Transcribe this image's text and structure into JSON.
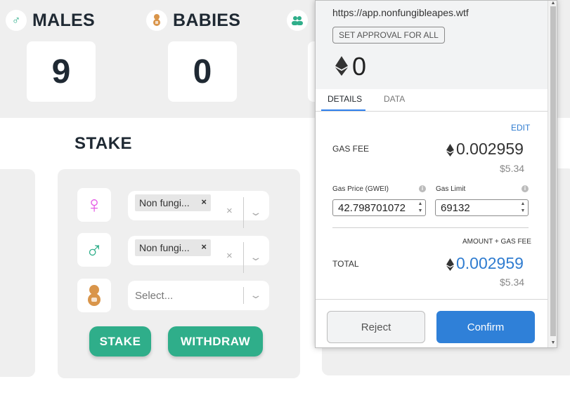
{
  "stats": {
    "males": {
      "label": "MALES",
      "value": "9",
      "icon": "male-icon"
    },
    "babies": {
      "label": "BABIES",
      "value": "0",
      "icon": "baby-icon"
    },
    "third": {
      "icon": "group-icon"
    }
  },
  "stake": {
    "title": "STAKE",
    "female_select": {
      "tag": "Non fungi...",
      "remove": "×",
      "clear": "×"
    },
    "male_select": {
      "tag": "Non fungi...",
      "remove": "×",
      "clear": "×"
    },
    "baby_select": {
      "placeholder": "Select..."
    },
    "stake_button": "STAKE",
    "withdraw_button": "WITHDRAW",
    "icons": {
      "female": "♀",
      "male": "♂",
      "baby": "baby-icon",
      "chevron": "chevron-down-icon"
    }
  },
  "colors": {
    "accent_green": "#2fae8a",
    "female_pink": "#e55ce6",
    "male_teal": "#2fae8a",
    "baby_orange": "#d9954a",
    "confirm_blue": "#2f80d8",
    "link_blue": "#2f7cd0"
  },
  "wallet": {
    "origin": "https://app.nonfungibleapes.wtf",
    "approval_label": "SET APPROVAL FOR ALL",
    "amount": "0",
    "tabs": [
      "DETAILS",
      "DATA"
    ],
    "active_tab": "DETAILS",
    "edit_label": "EDIT",
    "gas_fee_label": "GAS FEE",
    "gas_fee_eth": "0.002959",
    "gas_fee_fiat": "$5.34",
    "gas_price_label": "Gas Price (GWEI)",
    "gas_price_value": "42.798701072",
    "gas_limit_label": "Gas Limit",
    "gas_limit_value": "69132",
    "amount_gas_label": "AMOUNT + GAS FEE",
    "total_label": "TOTAL",
    "total_eth": "0.002959",
    "total_fiat": "$5.34",
    "reject_label": "Reject",
    "confirm_label": "Confirm",
    "info_glyph": "i"
  }
}
